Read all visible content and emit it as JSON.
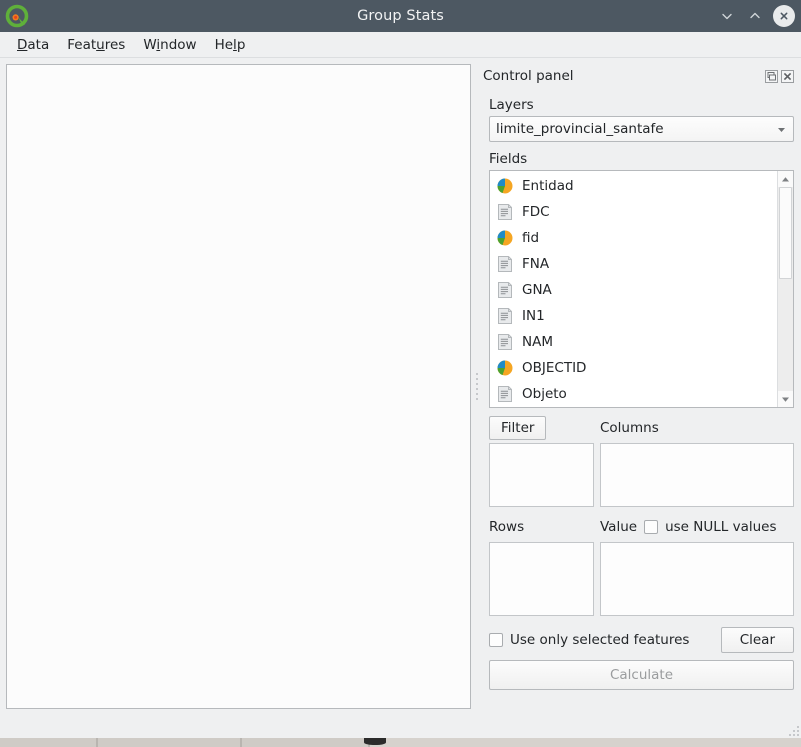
{
  "window": {
    "title": "Group Stats",
    "logo_icon": "qgis-logo-icon",
    "minimize_icon": "chevron-down-icon",
    "maximize_icon": "chevron-up-icon",
    "close_icon": "close-icon"
  },
  "menubar": {
    "items": [
      {
        "label": "Data",
        "pre": "",
        "mnemonic": "D",
        "post": "ata"
      },
      {
        "label": "Features",
        "pre": "Feat",
        "mnemonic": "u",
        "post": "res"
      },
      {
        "label": "Window",
        "pre": "W",
        "mnemonic": "i",
        "post": "ndow"
      },
      {
        "label": "Help",
        "pre": "He",
        "mnemonic": "l",
        "post": "p"
      }
    ]
  },
  "panel": {
    "title": "Control panel",
    "float_icon": "undock-panel-icon",
    "close_icon": "close-panel-icon",
    "layers_label": "Layers",
    "layer_selected": "limite_provincial_santafe",
    "dropdown_icon": "chevron-down-icon",
    "fields_label": "Fields",
    "fields": [
      {
        "name": "Entidad",
        "type": "numeric"
      },
      {
        "name": "FDC",
        "type": "text"
      },
      {
        "name": "fid",
        "type": "numeric"
      },
      {
        "name": "FNA",
        "type": "text"
      },
      {
        "name": "GNA",
        "type": "text"
      },
      {
        "name": "IN1",
        "type": "text"
      },
      {
        "name": "NAM",
        "type": "text"
      },
      {
        "name": "OBJECTID",
        "type": "numeric"
      },
      {
        "name": "Objeto",
        "type": "text"
      }
    ],
    "scroll_up_icon": "scroll-up-arrow-icon",
    "scroll_down_icon": "scroll-down-arrow-icon",
    "filter_label": "Filter",
    "columns_label": "Columns",
    "rows_label": "Rows",
    "value_label": "Value",
    "use_null_label": "use NULL values",
    "use_null_checked": false,
    "use_selected_label": "Use only selected features",
    "use_selected_checked": false,
    "clear_label": "Clear",
    "calculate_label": "Calculate",
    "calculate_enabled": false
  },
  "colors": {
    "titlebar": "#4d5862",
    "window_bg": "#eff0f1",
    "result_bg": "#fcfcfc",
    "numeric_field_green": "#4ca22f",
    "numeric_field_blue": "#1f8bc6",
    "numeric_field_orange": "#f5a623",
    "text_field_gray": "#d5d8da",
    "disabled_text": "#9a9c9e"
  }
}
